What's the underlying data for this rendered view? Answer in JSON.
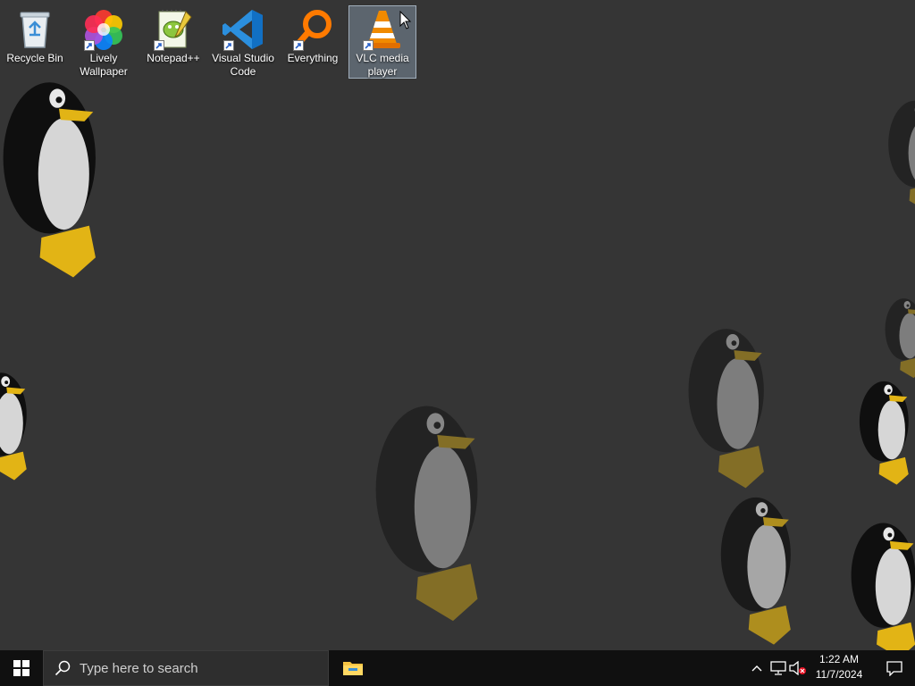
{
  "desktop": {
    "icons": [
      {
        "label": "Recycle Bin",
        "icon": "recycle-bin-icon"
      },
      {
        "label": "Lively Wallpaper",
        "icon": "lively-wallpaper-icon"
      },
      {
        "label": "Notepad++",
        "icon": "notepad-plus-plus-icon"
      },
      {
        "label": "Visual Studio Code",
        "icon": "vscode-icon"
      },
      {
        "label": "Everything",
        "icon": "everything-search-icon"
      },
      {
        "label": "VLC media player",
        "icon": "vlc-icon",
        "selected": true
      }
    ]
  },
  "taskbar": {
    "search_placeholder": "Type here to search",
    "pinned": [
      {
        "icon": "file-explorer-icon"
      }
    ],
    "tray": {
      "time": "1:22 AM",
      "date": "11/7/2024"
    }
  },
  "colors": {
    "desktop_bg": "#353535",
    "taskbar_bg": "#101010",
    "search_bg": "#2e2e2e",
    "vscode_blue": "#2b8fde",
    "vlc_orange": "#f08a00",
    "everything_orange": "#ff7a00"
  }
}
